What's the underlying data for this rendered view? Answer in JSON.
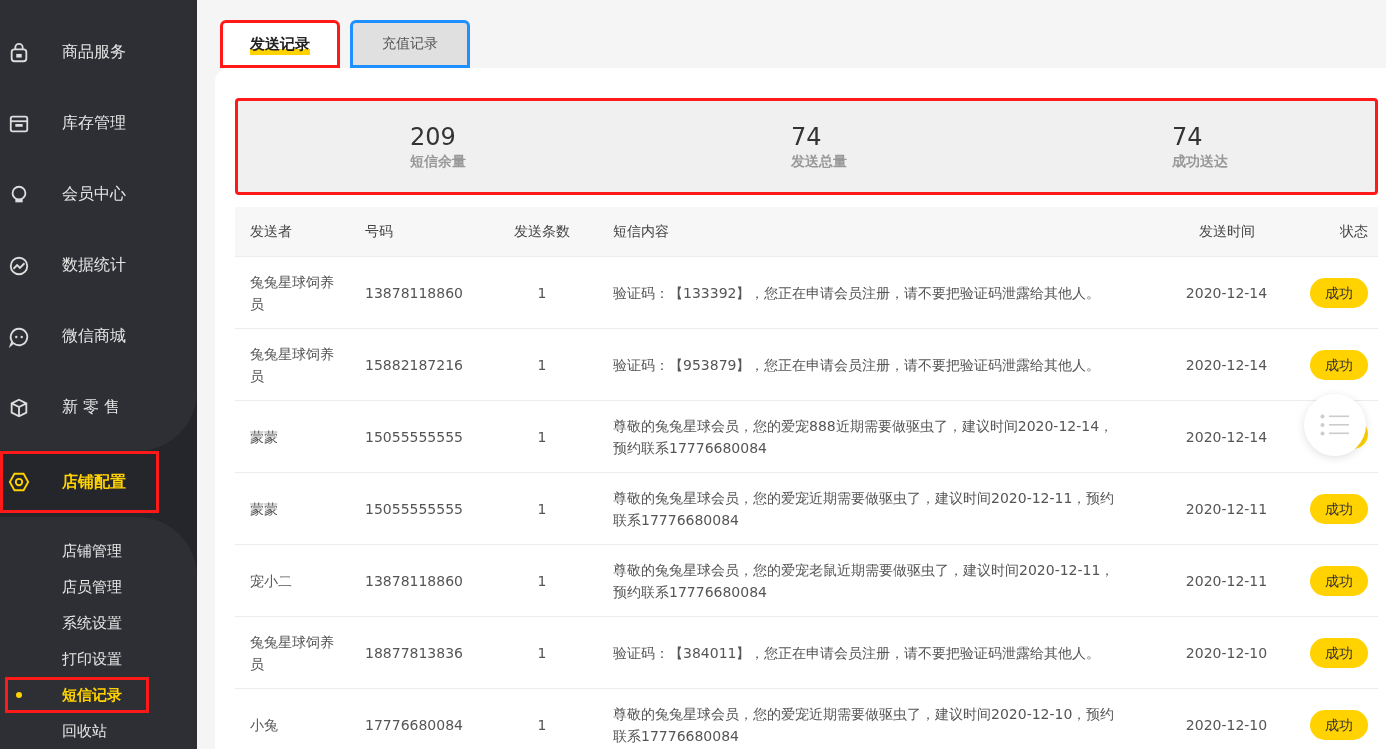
{
  "sidebar": {
    "items": [
      {
        "label": "商品服务",
        "kind": "bag",
        "selected": false
      },
      {
        "label": "库存管理",
        "kind": "box",
        "selected": false
      },
      {
        "label": "会员中心",
        "kind": "member",
        "selected": false
      },
      {
        "label": "数据统计",
        "kind": "chart",
        "selected": false
      },
      {
        "label": "微信商城",
        "kind": "chat",
        "selected": false
      },
      {
        "label": "新 零 售",
        "kind": "cube",
        "selected": false
      },
      {
        "label": "店铺配置",
        "kind": "hex",
        "selected": true,
        "expanded": true,
        "color": "#ff1a1a",
        "children": [
          {
            "label": "店铺管理",
            "selected": false
          },
          {
            "label": "店员管理",
            "selected": false
          },
          {
            "label": "系统设置",
            "selected": false
          },
          {
            "label": "打印设置",
            "selected": false
          },
          {
            "label": "短信记录",
            "selected": true,
            "color": "#ff1a1a"
          },
          {
            "label": "回收站",
            "selected": false
          }
        ]
      }
    ]
  },
  "tabs": [
    {
      "label": "发送记录",
      "selected": true,
      "color": "#ff1a1a"
    },
    {
      "label": "充值记录",
      "selected": false,
      "color": "#1e90ff"
    }
  ],
  "stats": {
    "color": "#ff1a1a",
    "items": [
      {
        "value": "209",
        "label": "短信余量"
      },
      {
        "value": "74",
        "label": "发送总量"
      },
      {
        "value": "74",
        "label": "成功送达"
      }
    ]
  },
  "table": {
    "columns": [
      "发送者",
      "号码",
      "发送条数",
      "短信内容",
      "发送时间",
      "状态"
    ],
    "rows": [
      {
        "sender": "兔兔星球饲养员",
        "phone": "13878118860",
        "count": "1",
        "content": "验证码：【133392】，您正在申请会员注册，请不要把验证码泄露给其他人。",
        "time": "2020-12-14",
        "status": "成功"
      },
      {
        "sender": "兔兔星球饲养员",
        "phone": "15882187216",
        "count": "1",
        "content": "验证码：【953879】，您正在申请会员注册，请不要把验证码泄露给其他人。",
        "time": "2020-12-14",
        "status": "成功"
      },
      {
        "sender": "蒙蒙",
        "phone": "15055555555",
        "count": "1",
        "content": "尊敬的兔兔星球会员，您的爱宠888近期需要做驱虫了，建议时间2020-12-14，预约联系17776680084",
        "time": "2020-12-14"
      },
      {
        "sender": "蒙蒙",
        "phone": "15055555555",
        "count": "1",
        "content": "尊敬的兔兔星球会员，您的爱宠近期需要做驱虫了，建议时间2020-12-11，预约联系17776680084",
        "time": "2020-12-11",
        "status": "成功"
      },
      {
        "sender": "宠小二",
        "phone": "13878118860",
        "count": "1",
        "content": "尊敬的兔兔星球会员，您的爱宠老鼠近期需要做驱虫了，建议时间2020-12-11，预约联系17776680084",
        "time": "2020-12-11",
        "status": "成功"
      },
      {
        "sender": "兔兔星球饲养员",
        "phone": "18877813836",
        "count": "1",
        "content": "验证码：【384011】，您正在申请会员注册，请不要把验证码泄露给其他人。",
        "time": "2020-12-10",
        "status": "成功"
      },
      {
        "sender": "小兔",
        "phone": "17776680084",
        "count": "1",
        "content": "尊敬的兔兔星球会员，您的爱宠近期需要做驱虫了，建议时间2020-12-10，预约联系17776680084",
        "time": "2020-12-10",
        "status": "成功"
      }
    ]
  }
}
